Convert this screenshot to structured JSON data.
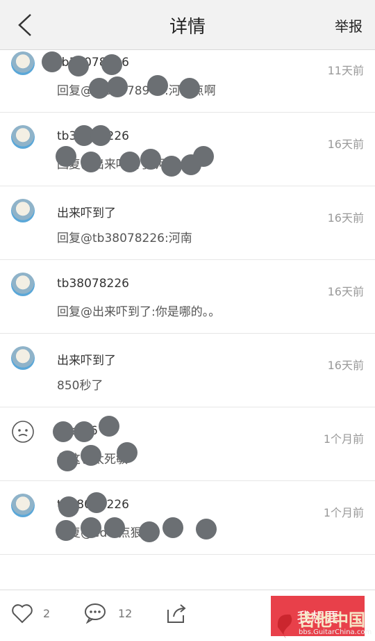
{
  "header": {
    "title": "详情",
    "report": "举报"
  },
  "comments": [
    {
      "name": "tb38078226",
      "reply": "回复@tb38078900:河南点啊",
      "time": "11天前"
    },
    {
      "name": "tb38078226",
      "reply": "回复@出来吓到了:河南点",
      "time": "16天前"
    },
    {
      "name": "出来吓到了",
      "reply": "回复@tb38078226:河南",
      "time": "16天前"
    },
    {
      "name": "tb38078226",
      "reply": "回复@出来吓到了:你是哪的。。",
      "time": "16天前"
    },
    {
      "name": "出来吓到了",
      "reply": "850秒了",
      "time": "16天前"
    },
    {
      "name": "user56",
      "reply": "你这也太死敏",
      "time": "1个月前"
    },
    {
      "name": "tb38078226",
      "reply": "回复@ed4:点狠",
      "time": "1个月前"
    }
  ],
  "footer": {
    "likes": "2",
    "comments_count": "12",
    "cta": "我想要"
  },
  "watermark": {
    "text": "吉他中国",
    "url": "bbs.GuitarChina.com"
  }
}
